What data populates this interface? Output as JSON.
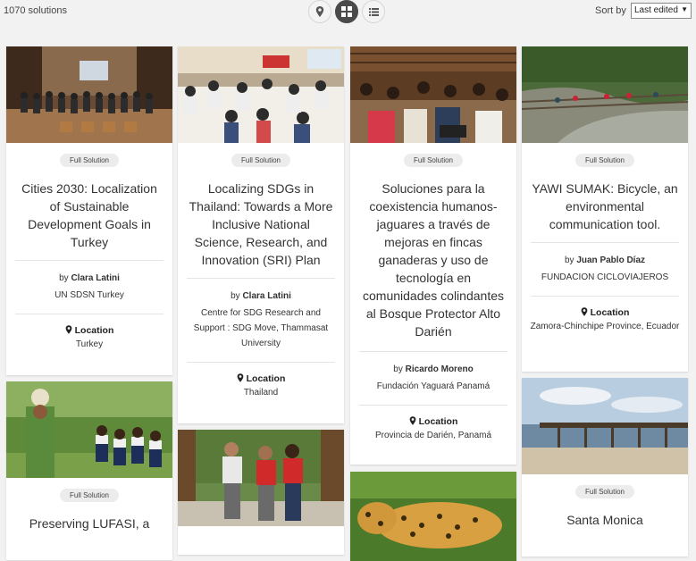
{
  "header": {
    "count": "1070 solutions",
    "sort_label": "Sort by",
    "sort_value": "Last edited"
  },
  "views": [
    {
      "icon": "map-pin-icon"
    },
    {
      "icon": "grid-icon",
      "active": true
    },
    {
      "icon": "list-icon"
    }
  ],
  "cards": [
    {
      "badge": "Full Solution",
      "title": "Cities 2030: Localization of Sustainable Development Goals in Turkey",
      "by": "by",
      "author": "Clara Latini",
      "org": "UN SDSN Turkey",
      "location_label": "Location",
      "location": "Turkey"
    },
    {
      "badge": "Full Solution",
      "title": "Localizing SDGs in Thailand: Towards a More Inclusive National Science, Research, and Innovation (SRI) Plan",
      "by": "by",
      "author": "Clara Latini",
      "org": "Centre for SDG Research and Support : SDG Move, Thammasat University",
      "location_label": "Location",
      "location": "Thailand"
    },
    {
      "badge": "Full Solution",
      "title": "Soluciones para la coexistencia humanos-jaguares a través de mejoras en fincas ganaderas y uso de tecnología en comunidades colindantes al Bosque Protector Alto Darién",
      "by": "by",
      "author": "Ricardo Moreno",
      "org": "Fundación Yaguará Panamá",
      "location_label": "Location",
      "location": "Provincia de Darién, Panamá"
    },
    {
      "badge": "Full Solution",
      "title": "YAWI SUMAK: Bicycle, an environmental communication tool.",
      "by": "by",
      "author": "Juan Pablo Díaz",
      "org": "FUNDACION CICLOVIAJEROS",
      "location_label": "Location",
      "location": "Zamora-Chinchipe Province, Ecuador"
    },
    {
      "badge": "Full Solution",
      "title": "Preserving LUFASI, a"
    },
    {
      "badge": ""
    },
    {
      "badge": ""
    },
    {
      "badge": "Full Solution",
      "title": "Santa Monica"
    }
  ]
}
